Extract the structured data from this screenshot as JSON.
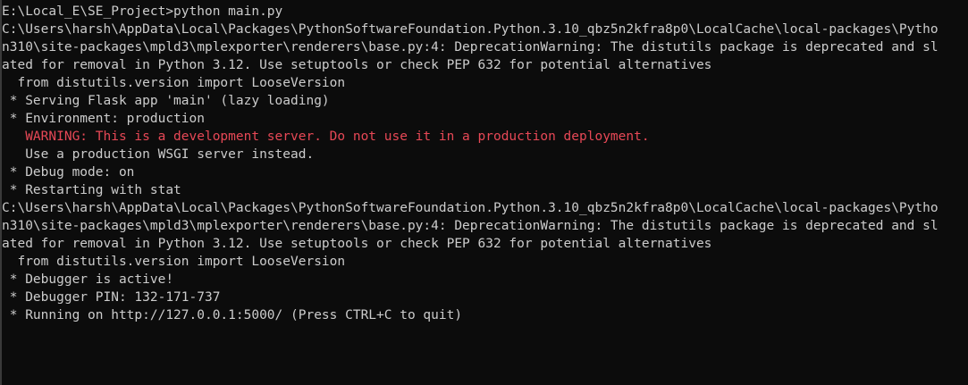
{
  "terminal": {
    "colors": {
      "background": "#0c0c0c",
      "foreground": "#cccccc",
      "warning": "#e74856"
    },
    "lines": [
      {
        "text": "E:\\Local_E\\SE_Project>python main.py",
        "style": "normal"
      },
      {
        "text": "C:\\Users\\harsh\\AppData\\Local\\Packages\\PythonSoftwareFoundation.Python.3.10_qbz5n2kfra8p0\\LocalCache\\local-packages\\Pytho",
        "style": "normal"
      },
      {
        "text": "n310\\site-packages\\mpld3\\mplexporter\\renderers\\base.py:4: DeprecationWarning: The distutils package is deprecated and sl",
        "style": "normal"
      },
      {
        "text": "ated for removal in Python 3.12. Use setuptools or check PEP 632 for potential alternatives",
        "style": "normal"
      },
      {
        "text": "  from distutils.version import LooseVersion",
        "style": "normal"
      },
      {
        "text": " * Serving Flask app 'main' (lazy loading)",
        "style": "normal"
      },
      {
        "text": " * Environment: production",
        "style": "normal"
      },
      {
        "text": "   WARNING: This is a development server. Do not use it in a production deployment.",
        "style": "warn"
      },
      {
        "text": "   Use a production WSGI server instead.",
        "style": "normal"
      },
      {
        "text": " * Debug mode: on",
        "style": "normal"
      },
      {
        "text": " * Restarting with stat",
        "style": "normal"
      },
      {
        "text": "C:\\Users\\harsh\\AppData\\Local\\Packages\\PythonSoftwareFoundation.Python.3.10_qbz5n2kfra8p0\\LocalCache\\local-packages\\Pytho",
        "style": "normal"
      },
      {
        "text": "n310\\site-packages\\mpld3\\mplexporter\\renderers\\base.py:4: DeprecationWarning: The distutils package is deprecated and sl",
        "style": "normal"
      },
      {
        "text": "ated for removal in Python 3.12. Use setuptools or check PEP 632 for potential alternatives",
        "style": "normal"
      },
      {
        "text": "  from distutils.version import LooseVersion",
        "style": "normal"
      },
      {
        "text": " * Debugger is active!",
        "style": "normal"
      },
      {
        "text": " * Debugger PIN: 132-171-737",
        "style": "normal"
      },
      {
        "text": " * Running on http://127.0.0.1:5000/ (Press CTRL+C to quit)",
        "style": "normal"
      }
    ]
  }
}
